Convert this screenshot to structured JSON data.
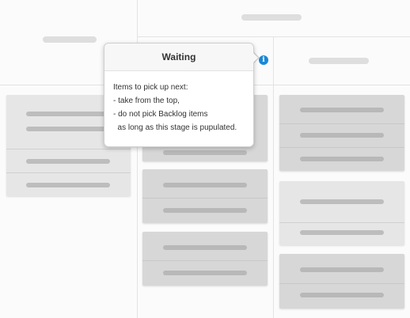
{
  "tooltip": {
    "title": "Waiting",
    "lines": [
      "Items to pick up next:",
      "- take from the top,",
      "- do not pick Backlog items",
      "  as long as this stage is pupulated."
    ]
  },
  "info_icon": {
    "name": "info-icon",
    "glyph": "i",
    "color": "#1a88d6"
  }
}
